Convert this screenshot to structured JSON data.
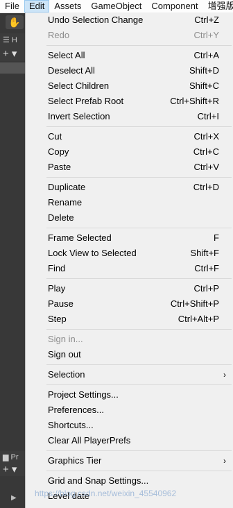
{
  "menubar": {
    "items": [
      "File",
      "Edit",
      "Assets",
      "GameObject",
      "Component",
      "增强版功"
    ]
  },
  "editor": {
    "hand_icon": "hand-icon",
    "panel1_label": "☰ H",
    "panel1_plus": "+ ▾",
    "panel2_label": "▆ Pr",
    "panel2_plus": "+ ▾",
    "panel2_arrow": "▶"
  },
  "menu": {
    "groups": [
      [
        {
          "label": "Undo Selection Change",
          "shortcut": "Ctrl+Z"
        },
        {
          "label": "Redo",
          "shortcut": "Ctrl+Y",
          "disabled": true
        }
      ],
      [
        {
          "label": "Select All",
          "shortcut": "Ctrl+A"
        },
        {
          "label": "Deselect All",
          "shortcut": "Shift+D"
        },
        {
          "label": "Select Children",
          "shortcut": "Shift+C"
        },
        {
          "label": "Select Prefab Root",
          "shortcut": "Ctrl+Shift+R"
        },
        {
          "label": "Invert Selection",
          "shortcut": "Ctrl+I"
        }
      ],
      [
        {
          "label": "Cut",
          "shortcut": "Ctrl+X"
        },
        {
          "label": "Copy",
          "shortcut": "Ctrl+C"
        },
        {
          "label": "Paste",
          "shortcut": "Ctrl+V"
        }
      ],
      [
        {
          "label": "Duplicate",
          "shortcut": "Ctrl+D"
        },
        {
          "label": "Rename",
          "shortcut": ""
        },
        {
          "label": "Delete",
          "shortcut": ""
        }
      ],
      [
        {
          "label": "Frame Selected",
          "shortcut": "F"
        },
        {
          "label": "Lock View to Selected",
          "shortcut": "Shift+F"
        },
        {
          "label": "Find",
          "shortcut": "Ctrl+F"
        }
      ],
      [
        {
          "label": "Play",
          "shortcut": "Ctrl+P"
        },
        {
          "label": "Pause",
          "shortcut": "Ctrl+Shift+P"
        },
        {
          "label": "Step",
          "shortcut": "Ctrl+Alt+P"
        }
      ],
      [
        {
          "label": "Sign in...",
          "shortcut": "",
          "disabled": true
        },
        {
          "label": "Sign out",
          "shortcut": ""
        }
      ],
      [
        {
          "label": "Selection",
          "shortcut": "",
          "submenu": true
        }
      ],
      [
        {
          "label": "Project Settings...",
          "shortcut": ""
        },
        {
          "label": "Preferences...",
          "shortcut": ""
        },
        {
          "label": "Shortcuts...",
          "shortcut": ""
        },
        {
          "label": "Clear All PlayerPrefs",
          "shortcut": ""
        }
      ],
      [
        {
          "label": "Graphics Tier",
          "shortcut": "",
          "submenu": true
        }
      ],
      [
        {
          "label": "Grid and Snap Settings...",
          "shortcut": ""
        },
        {
          "label": "Level date",
          "shortcut": ""
        }
      ]
    ],
    "submenu_arrow": "›"
  },
  "watermark": "https://blog.csdn.net/weixin_45540962"
}
